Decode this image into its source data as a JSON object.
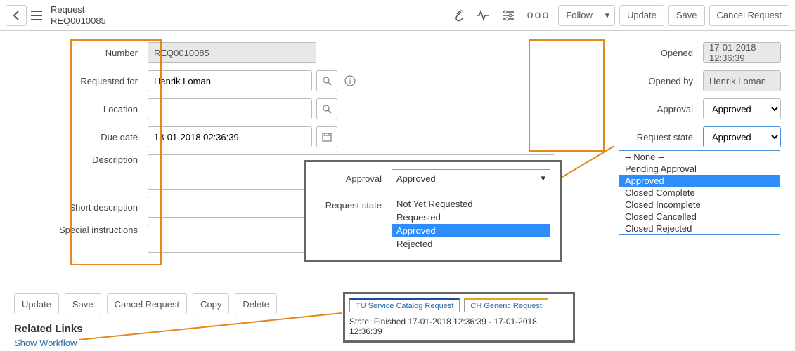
{
  "header": {
    "title": "Request",
    "record_number": "REQ0010085",
    "follow": "Follow",
    "update": "Update",
    "save": "Save",
    "cancel": "Cancel Request"
  },
  "left_labels": {
    "number": "Number",
    "requested_for": "Requested for",
    "location": "Location",
    "due_date": "Due date",
    "description": "Description",
    "short_description": "Short description",
    "special_instructions": "Special instructions"
  },
  "left_values": {
    "number": "REQ0010085",
    "requested_for": "Henrik Loman",
    "location": "",
    "due_date": "18-01-2018 02:36:39"
  },
  "right_labels": {
    "opened": "Opened",
    "opened_by": "Opened by",
    "approval": "Approval",
    "request_state": "Request state"
  },
  "right_values": {
    "opened": "17-01-2018 12:36:39",
    "opened_by": "Henrik Loman",
    "approval": "Approved",
    "request_state": "Approved"
  },
  "overlay1": {
    "approval_label": "Approval",
    "approval_value": "Approved",
    "state_label": "Request state",
    "options": [
      "Not Yet Requested",
      "Requested",
      "Approved",
      "Rejected"
    ],
    "selected": "Approved"
  },
  "state_dropdown": {
    "options": [
      "-- None --",
      "Pending Approval",
      "Approved",
      "Closed Complete",
      "Closed Incomplete",
      "Closed Cancelled",
      "Closed Rejected"
    ],
    "selected": "Approved"
  },
  "bottom_buttons": {
    "update": "Update",
    "save": "Save",
    "cancel": "Cancel Request",
    "copy": "Copy",
    "delete": "Delete"
  },
  "related": {
    "heading": "Related Links",
    "show_workflow": "Show Workflow"
  },
  "workflow": {
    "tab1": "TU Service Catalog Request",
    "tab2": "CH Generic Request",
    "state": "State: Finished   17-01-2018 12:36:39 - 17-01-2018 12:36:39"
  }
}
